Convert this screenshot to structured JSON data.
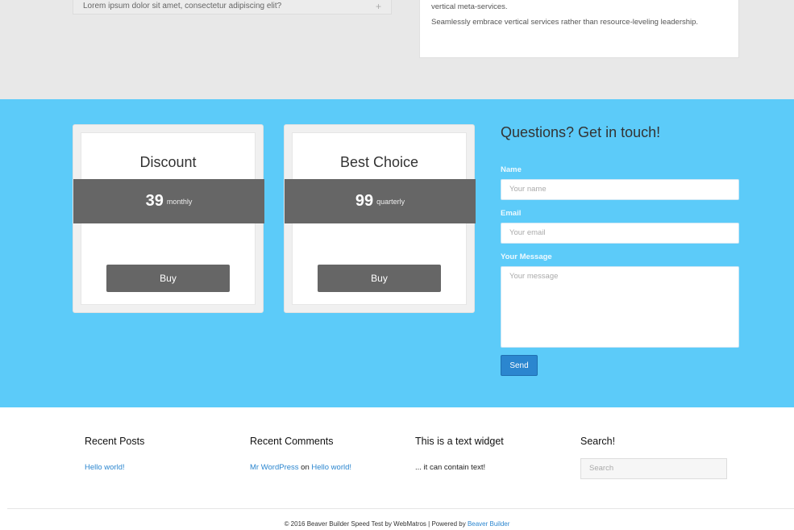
{
  "top": {
    "faq_question": "Lorem ipsum dolor sit amet, consectetur adipiscing elit?",
    "faq_icon": "plus-icon",
    "text_lines": [
      "vertical meta-services.",
      "Seamlessly embrace vertical services rather than resource-leveling leadership."
    ]
  },
  "pricing": [
    {
      "title": "Discount",
      "price": "39",
      "period": "monthly",
      "button": "Buy"
    },
    {
      "title": "Best Choice",
      "price": "99",
      "period": "quarterly",
      "button": "Buy"
    }
  ],
  "contact": {
    "heading": "Questions? Get in touch!",
    "name_label": "Name",
    "name_placeholder": "Your name",
    "email_label": "Email",
    "email_placeholder": "Your email",
    "message_label": "Your Message",
    "message_placeholder": "Your message",
    "send_label": "Send"
  },
  "footer": {
    "recent_posts": {
      "title": "Recent Posts",
      "post": "Hello world!"
    },
    "recent_comments": {
      "title": "Recent Comments",
      "author": "Mr WordPress",
      "on": "on",
      "post": "Hello world!"
    },
    "text_widget": {
      "title": "This is a text widget",
      "text": "... it can contain text!"
    },
    "search": {
      "title": "Search!",
      "placeholder": "Search"
    },
    "copyright": "© 2016 Beaver Builder Speed Test by WebMatros | Powered by",
    "powered_link": "Beaver Builder"
  },
  "colors": {
    "accent_blue": "#5ccbf9",
    "button_gray": "#666666",
    "send_blue": "#2b86cf",
    "link_blue": "#2b86cf"
  }
}
